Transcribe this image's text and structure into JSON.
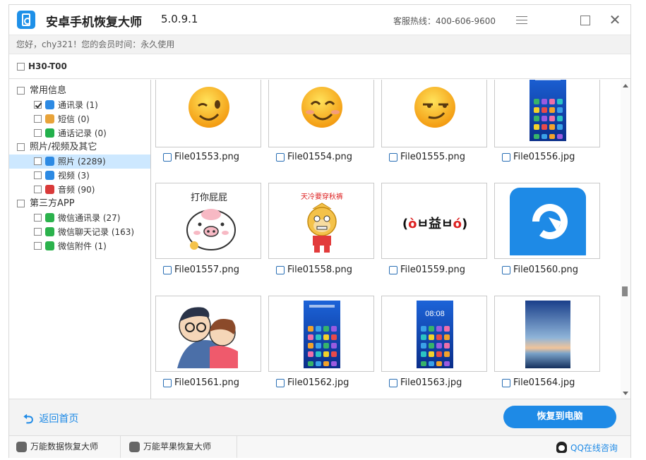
{
  "window": {
    "title": "安卓手机恢复大师",
    "version": "5.0.9.1",
    "hotline": "客服热线：400-606-9600",
    "close_glyph": "✕"
  },
  "greeting": "您好，chy321！您的会员时间：永久使用",
  "device": {
    "name": "H30-T00",
    "checked": false
  },
  "tree": {
    "categories": [
      {
        "label": "常用信息",
        "items": [
          {
            "label": "通讯录 (1)",
            "icon": "contacts-icon",
            "color": "#2d8ae3",
            "checked": true
          },
          {
            "label": "短信 (0)",
            "icon": "sms-icon",
            "color": "#e8a33a",
            "checked": false
          },
          {
            "label": "通话记录 (0)",
            "icon": "phone-icon",
            "color": "#22b04b",
            "checked": false
          }
        ]
      },
      {
        "label": "照片/视频及其它",
        "items": [
          {
            "label": "照片 (2289)",
            "icon": "photo-icon",
            "color": "#2d8ae3",
            "checked": false,
            "selected": true
          },
          {
            "label": "视频 (3)",
            "icon": "video-icon",
            "color": "#2d8ae3",
            "checked": false
          },
          {
            "label": "音频 (90)",
            "icon": "audio-icon",
            "color": "#d93a3a",
            "checked": false
          }
        ]
      },
      {
        "label": "第三方APP",
        "items": [
          {
            "label": "微信通讯录 (27)",
            "icon": "wechat-icon",
            "color": "#2bb24c",
            "checked": false
          },
          {
            "label": "微信聊天记录 (163)",
            "icon": "wechat-icon",
            "color": "#2bb24c",
            "checked": false
          },
          {
            "label": "微信附件 (1)",
            "icon": "wechat-icon",
            "color": "#2bb24c",
            "checked": false
          }
        ]
      }
    ]
  },
  "files": [
    {
      "name": "File01553.png",
      "thumb": "wink-emoji"
    },
    {
      "name": "File01554.png",
      "thumb": "smile-emoji"
    },
    {
      "name": "File01555.png",
      "thumb": "smirk-emoji"
    },
    {
      "name": "File01556.jpg",
      "thumb": "phone-homescreen"
    },
    {
      "name": "File01557.png",
      "thumb": "pig-sticker",
      "text": "打你屁屁"
    },
    {
      "name": "File01558.png",
      "thumb": "monkey-sticker",
      "text": "天冷要穿秋裤"
    },
    {
      "name": "File01559.png",
      "thumb": "text-emoticon"
    },
    {
      "name": "File01560.png",
      "thumb": "app-logo"
    },
    {
      "name": "File01561.png",
      "thumb": "couple-cartoon"
    },
    {
      "name": "File01562.jpg",
      "thumb": "phone-homescreen"
    },
    {
      "name": "File01563.jpg",
      "thumb": "phone-lockscreen",
      "time": "08:08"
    },
    {
      "name": "File01564.jpg",
      "thumb": "sunset-wallpaper"
    }
  ],
  "buttons": {
    "back": "返回首页",
    "recover": "恢复到电脑"
  },
  "footer": {
    "item1": "万能数据恢复大师",
    "item2": "万能苹果恢复大师",
    "qq": "QQ在线咨询"
  }
}
